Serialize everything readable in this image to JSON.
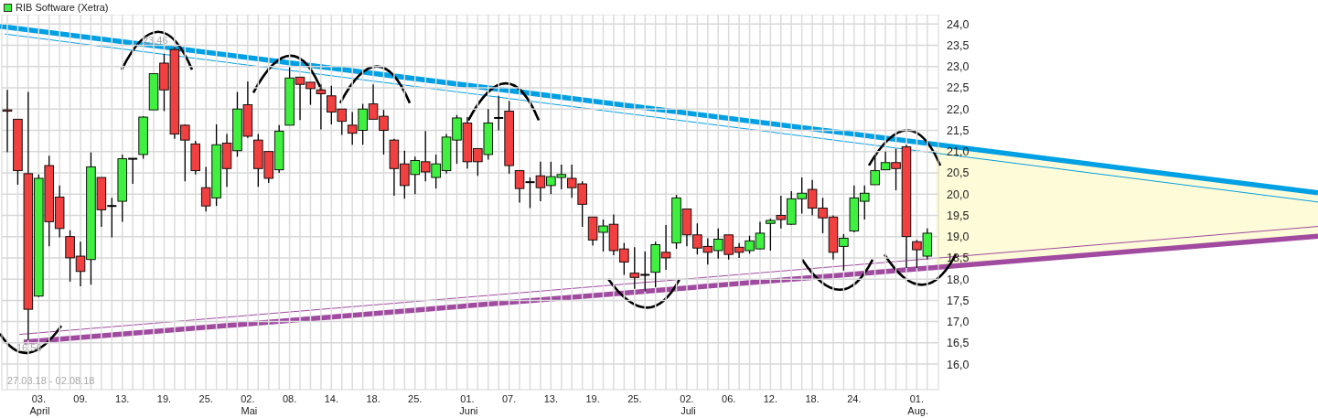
{
  "legend": {
    "label": "RIB Software (Xetra)"
  },
  "chart": {
    "range_label": "27.03.18 - 02.08.18",
    "high_label": "23,46",
    "low_label": "16,56",
    "chart_data": {
      "type": "candlestick",
      "ylim": [
        15.4,
        24.22
      ],
      "grid": true,
      "categories": [
        null,
        null,
        null,
        "03. April",
        null,
        null,
        null,
        "09.",
        null,
        null,
        null,
        "13.",
        null,
        null,
        null,
        "19.",
        null,
        null,
        null,
        "25.",
        null,
        null,
        null,
        "02. Mai",
        null,
        null,
        null,
        "08.",
        null,
        null,
        null,
        "14.",
        null,
        null,
        null,
        "18.",
        null,
        null,
        null,
        "25.",
        null,
        null,
        null,
        null,
        "01. Juni",
        null,
        null,
        null,
        "07.",
        null,
        null,
        null,
        "13.",
        null,
        null,
        null,
        "19.",
        null,
        null,
        null,
        "25.",
        null,
        null,
        null,
        null,
        "02. Juli",
        null,
        null,
        null,
        "06.",
        null,
        null,
        null,
        "12.",
        null,
        null,
        null,
        "18.",
        null,
        null,
        null,
        "24.",
        null,
        null,
        null,
        null,
        null,
        "01. Aug.",
        null
      ],
      "yticks": [
        {
          "value": 24,
          "label": "24,0"
        },
        {
          "value": 23.5,
          "label": "23,5"
        },
        {
          "value": 23,
          "label": "23,0"
        },
        {
          "value": 22.5,
          "label": "22,5"
        },
        {
          "value": 22,
          "label": "22,0"
        },
        {
          "value": 21.5,
          "label": "21,5"
        },
        {
          "value": 21,
          "label": "21,0"
        },
        {
          "value": 20.5,
          "label": "20,5"
        },
        {
          "value": 20,
          "label": "20,0"
        },
        {
          "value": 19.5,
          "label": "19,5"
        },
        {
          "value": 19,
          "label": "19,0"
        },
        {
          "value": 18.5,
          "label": "18,5"
        },
        {
          "value": 18,
          "label": "18,0"
        },
        {
          "value": 17.5,
          "label": "17,5"
        },
        {
          "value": 17,
          "label": "17,0"
        },
        {
          "value": 16.5,
          "label": "16,5"
        },
        {
          "value": 16,
          "label": "16,0"
        }
      ],
      "ohlc": [
        [
          21.98,
          22.45,
          20.98,
          21.95
        ],
        [
          21.76,
          21.76,
          20.22,
          20.55
        ],
        [
          20.48,
          22.4,
          16.56,
          17.29
        ],
        [
          17.6,
          20.46,
          17.58,
          20.37
        ],
        [
          20.67,
          20.9,
          18.77,
          19.35
        ],
        [
          19.93,
          20.2,
          18.98,
          19.19
        ],
        [
          19.0,
          19.15,
          17.94,
          18.5
        ],
        [
          18.54,
          18.88,
          17.83,
          18.18
        ],
        [
          18.46,
          20.98,
          17.87,
          20.64
        ],
        [
          20.39,
          20.39,
          19.23,
          19.63
        ],
        [
          19.72,
          19.91,
          18.98,
          19.72
        ],
        [
          19.83,
          20.93,
          19.35,
          20.83
        ],
        [
          20.83,
          20.83,
          20.24,
          20.83
        ],
        [
          20.93,
          21.83,
          20.83,
          21.81
        ],
        [
          21.98,
          22.83,
          21.98,
          22.83
        ],
        [
          23.08,
          23.3,
          21.95,
          22.45
        ],
        [
          23.4,
          23.46,
          21.3,
          21.41
        ],
        [
          21.62,
          21.64,
          20.3,
          21.27
        ],
        [
          21.18,
          21.25,
          20.46,
          20.55
        ],
        [
          20.15,
          20.64,
          19.59,
          19.72
        ],
        [
          19.91,
          21.64,
          19.72,
          21.16
        ],
        [
          21.2,
          21.41,
          20.17,
          20.6
        ],
        [
          21.02,
          22.4,
          20.88,
          22.0
        ],
        [
          22.1,
          22.65,
          21.32,
          21.36
        ],
        [
          21.27,
          21.41,
          20.17,
          20.6
        ],
        [
          21.0,
          21.0,
          20.26,
          20.37
        ],
        [
          20.57,
          21.62,
          20.5,
          21.48
        ],
        [
          21.62,
          22.98,
          21.62,
          22.73
        ],
        [
          22.75,
          22.75,
          21.74,
          22.58
        ],
        [
          22.63,
          22.63,
          22.1,
          22.48
        ],
        [
          22.45,
          22.58,
          21.52,
          22.36
        ],
        [
          22.31,
          22.55,
          21.64,
          21.93
        ],
        [
          22.0,
          22.0,
          21.39,
          21.71
        ],
        [
          21.62,
          21.93,
          21.16,
          21.43
        ],
        [
          21.5,
          22.12,
          21.16,
          22.0
        ],
        [
          22.12,
          22.58,
          21.76,
          21.76
        ],
        [
          21.83,
          21.98,
          20.93,
          21.5
        ],
        [
          21.27,
          21.3,
          19.96,
          20.6
        ],
        [
          20.71,
          21.02,
          19.89,
          20.2
        ],
        [
          20.46,
          20.88,
          20.0,
          20.79
        ],
        [
          20.76,
          21.48,
          20.3,
          20.52
        ],
        [
          20.39,
          20.93,
          20.13,
          20.71
        ],
        [
          20.55,
          21.41,
          20.48,
          21.34
        ],
        [
          21.27,
          21.86,
          20.71,
          21.79
        ],
        [
          21.67,
          21.81,
          20.6,
          20.76
        ],
        [
          21.07,
          21.07,
          20.43,
          20.76
        ],
        [
          20.93,
          22.0,
          20.81,
          21.67
        ],
        [
          21.79,
          22.31,
          21.5,
          21.79
        ],
        [
          21.95,
          22.19,
          20.48,
          20.67
        ],
        [
          20.55,
          20.55,
          19.8,
          20.13
        ],
        [
          20.28,
          20.39,
          19.67,
          20.28
        ],
        [
          20.43,
          20.76,
          19.83,
          20.15
        ],
        [
          20.2,
          20.76,
          20.0,
          20.41
        ],
        [
          20.39,
          20.69,
          20.11,
          20.46
        ],
        [
          20.37,
          20.69,
          19.91,
          20.15
        ],
        [
          20.24,
          20.3,
          19.23,
          19.76
        ],
        [
          19.46,
          19.46,
          18.79,
          18.92
        ],
        [
          19.1,
          19.4,
          18.65,
          19.25
        ],
        [
          19.29,
          19.52,
          18.56,
          18.67
        ],
        [
          18.71,
          18.85,
          18.1,
          18.4
        ],
        [
          18.14,
          18.75,
          17.77,
          18.04
        ],
        [
          18.1,
          18.65,
          17.71,
          18.1
        ],
        [
          18.16,
          18.88,
          17.81,
          18.81
        ],
        [
          18.63,
          19.27,
          18.22,
          18.5
        ],
        [
          18.85,
          19.98,
          18.71,
          19.91
        ],
        [
          19.65,
          19.65,
          18.77,
          19.04
        ],
        [
          19.04,
          19.31,
          18.58,
          18.73
        ],
        [
          18.77,
          18.96,
          18.34,
          18.63
        ],
        [
          18.67,
          19.19,
          18.48,
          18.94
        ],
        [
          19.04,
          19.04,
          18.46,
          18.58
        ],
        [
          18.75,
          18.85,
          18.5,
          18.63
        ],
        [
          18.67,
          19.02,
          18.6,
          18.9
        ],
        [
          18.71,
          19.35,
          18.69,
          19.08
        ],
        [
          19.31,
          19.42,
          18.67,
          19.38
        ],
        [
          19.5,
          19.96,
          19.19,
          19.4
        ],
        [
          19.29,
          20.07,
          19.27,
          19.89
        ],
        [
          19.89,
          20.39,
          19.54,
          20.02
        ],
        [
          20.11,
          20.33,
          19.5,
          19.67
        ],
        [
          19.67,
          19.91,
          19.08,
          19.44
        ],
        [
          19.46,
          19.5,
          18.46,
          18.63
        ],
        [
          18.77,
          19.06,
          18.2,
          18.96
        ],
        [
          19.13,
          20.2,
          19.1,
          19.91
        ],
        [
          19.83,
          20.2,
          19.4,
          20.02
        ],
        [
          20.22,
          20.93,
          20.22,
          20.55
        ],
        [
          20.57,
          21.0,
          20.57,
          20.74
        ],
        [
          20.74,
          21.07,
          20.09,
          20.6
        ],
        [
          21.11,
          21.16,
          18.26,
          19.0
        ],
        [
          18.88,
          18.92,
          18.26,
          18.69
        ],
        [
          18.54,
          19.19,
          18.46,
          19.08
        ]
      ]
    }
  }
}
